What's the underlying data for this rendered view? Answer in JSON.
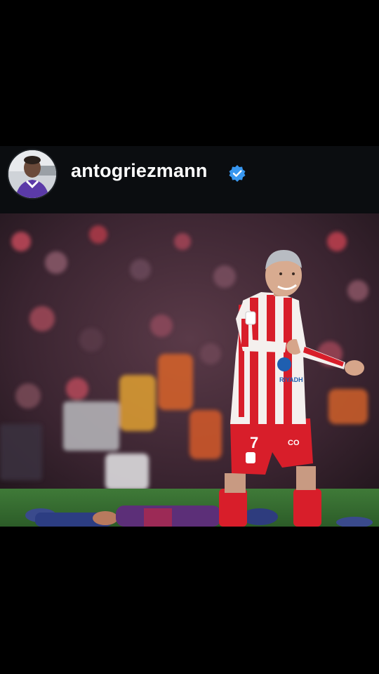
{
  "post": {
    "username": "antogriezmann",
    "verified": true,
    "avatar_icon": "profile-photo-child-purple-shirt",
    "verified_icon": "verified-badge-icon",
    "verified_color": "#3897f0",
    "photo_subject": "player-celebrating-photo"
  },
  "photo_text": {
    "shirt_number": "7",
    "shirt_sponsor": "RIYADH",
    "shorts_sponsor": "CO"
  }
}
